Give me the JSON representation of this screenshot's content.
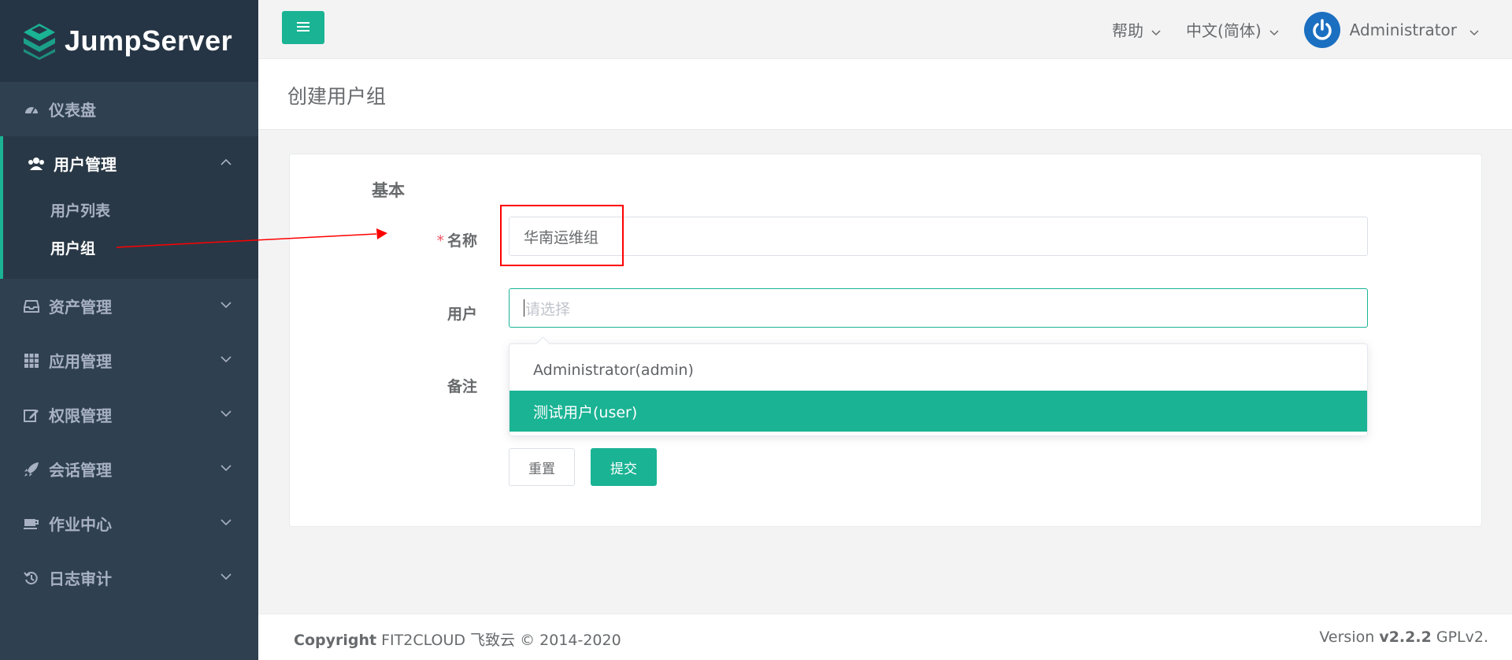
{
  "app": {
    "name": "JumpServer"
  },
  "sidebar": {
    "items": [
      {
        "label": "仪表盘",
        "icon": "dashboard-icon"
      },
      {
        "label": "用户管理",
        "icon": "users-icon",
        "expanded": true,
        "children": [
          {
            "label": "用户列表"
          },
          {
            "label": "用户组",
            "active": true
          }
        ]
      },
      {
        "label": "资产管理",
        "icon": "inbox-icon"
      },
      {
        "label": "应用管理",
        "icon": "grid-icon"
      },
      {
        "label": "权限管理",
        "icon": "edit-icon"
      },
      {
        "label": "会话管理",
        "icon": "rocket-icon"
      },
      {
        "label": "作业中心",
        "icon": "coffee-icon"
      },
      {
        "label": "日志审计",
        "icon": "history-icon"
      }
    ]
  },
  "topbar": {
    "help": "帮助",
    "language": "中文(简体)",
    "user": "Administrator"
  },
  "page": {
    "title": "创建用户组"
  },
  "form": {
    "section": "基本",
    "name_label": "名称",
    "name_value": "华南运维组",
    "users_label": "用户",
    "users_placeholder": "请选择",
    "comment_label": "备注",
    "options": [
      {
        "label": "Administrator(admin)",
        "selected": false
      },
      {
        "label": "测试用户(user)",
        "selected": true
      }
    ],
    "reset_label": "重置",
    "submit_label": "提交"
  },
  "footer": {
    "copyright_bold": "Copyright",
    "copyright_text": "FIT2CLOUD 飞致云 © 2014-2020",
    "version_prefix": "Version",
    "version": "v2.2.2",
    "license": "GPLv2."
  },
  "colors": {
    "accent": "#1ab394",
    "sidebar": "#2f4050",
    "annotation": "#ff0000"
  }
}
